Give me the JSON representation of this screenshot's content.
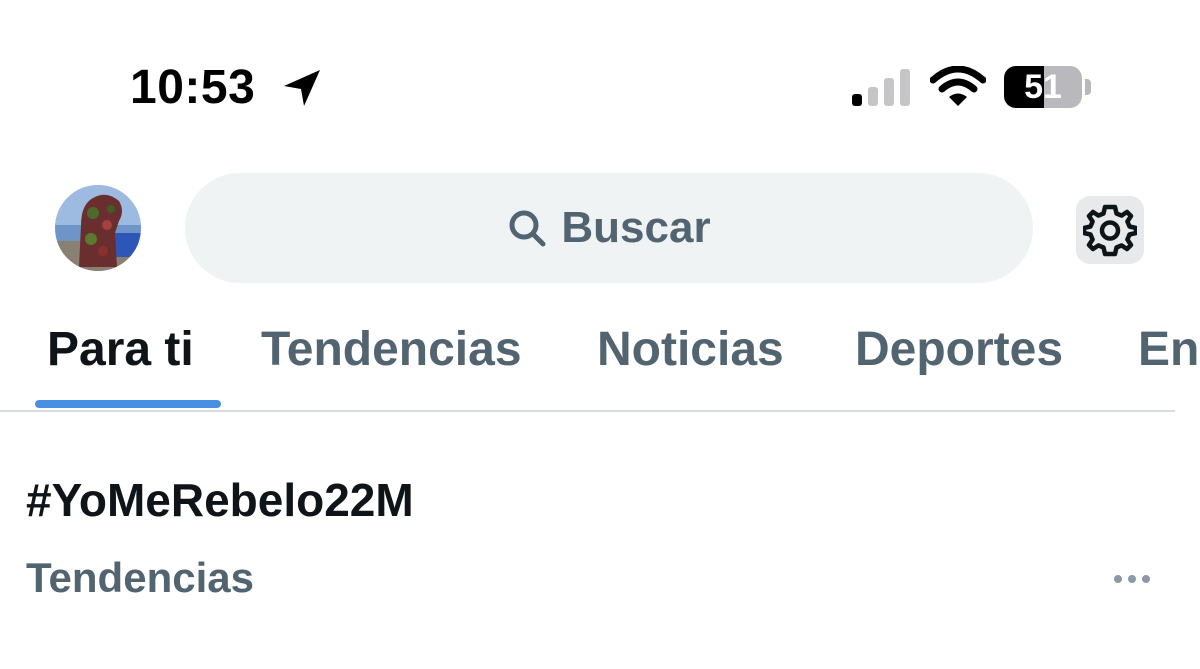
{
  "status_bar": {
    "time": "10:53",
    "battery_level": "51",
    "battery_percent": 51,
    "icons": [
      "location-arrow-icon",
      "cellular-signal-icon",
      "wifi-icon",
      "battery-icon"
    ]
  },
  "header": {
    "avatar": "profile-avatar",
    "search": {
      "placeholder": "Buscar",
      "icon": "search-icon"
    },
    "settings_icon": "gear-icon"
  },
  "tabs": [
    {
      "label": "Para ti",
      "active": true
    },
    {
      "label": "Tendencias",
      "active": false
    },
    {
      "label": "Noticias",
      "active": false
    },
    {
      "label": "Deportes",
      "active": false
    },
    {
      "label": "En",
      "active": false
    }
  ],
  "trends": [
    {
      "title": "#YoMeRebelo22M",
      "category": "Tendencias",
      "more_icon": "more-horizontal-icon"
    }
  ],
  "colors": {
    "text_primary": "#0f1419",
    "text_secondary": "#536471",
    "accent": "#4a90e2",
    "search_bg": "#eff3f4"
  }
}
